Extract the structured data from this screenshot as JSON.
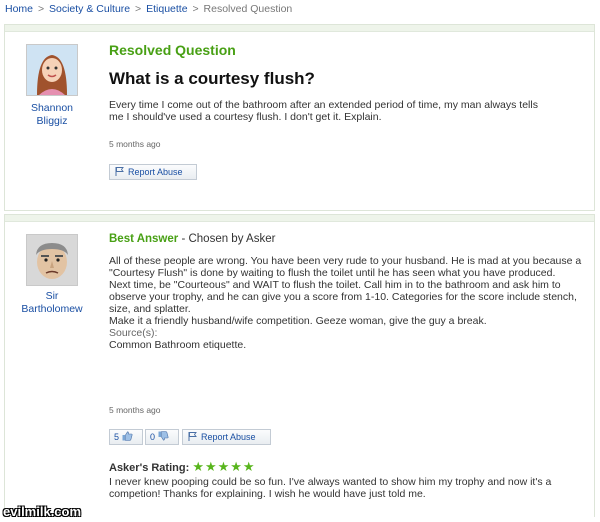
{
  "breadcrumb": {
    "home": "Home",
    "category": "Society & Culture",
    "subcategory": "Etiquette",
    "current": "Resolved Question",
    "separator": ">"
  },
  "question": {
    "status": "Resolved Question",
    "title": "What is a courtesy flush?",
    "asker_first": "Shannon",
    "asker_last": "Bliggiz",
    "body": "Every time I come out of the bathroom after an extended period of time, my man always tells me I should've used a courtesy flush. I don't get it. Explain.",
    "timestamp": "5 months ago",
    "report_label": "Report Abuse"
  },
  "answer": {
    "label": "Best Answer",
    "chosen_by": "- Chosen by Asker",
    "answerer_first": "Sir",
    "answerer_last": "Bartholomew",
    "paragraph1": "All of these people are wrong. You have been very rude to your husband. He is mad at you because a \"Courtesy Flush\" is done by waiting to flush the toilet until he has seen what you have produced.",
    "paragraph2": "Next time, be \"Courteous\" and WAIT to flush the toilet. Call him in to the bathroom and ask him to observe your trophy, and he can give you a score from 1-10. Categories for the score include stench, size, and splatter.",
    "paragraph3": "Make it a friendly husband/wife competition. Geeze woman, give the guy a break.",
    "sources_label": "Source(s):",
    "source": "Common Bathroom etiquette.",
    "timestamp": "5 months ago",
    "thumbs_up_count": "5",
    "thumbs_down_count": "0",
    "report_label": "Report Abuse",
    "rating_label": "Asker's Rating:",
    "rating_stars": "★★★★★",
    "rating_value": 5,
    "rating_comment": "I never knew pooping could be so fun. I've always wanted to show him my trophy and now it's a competion! Thanks for explaining. I wish he would have just told me."
  },
  "watermark": "evilmilk.com",
  "colors": {
    "link": "#1a4fa3",
    "accent_green": "#48a014",
    "panel_border": "#dde5d8"
  }
}
